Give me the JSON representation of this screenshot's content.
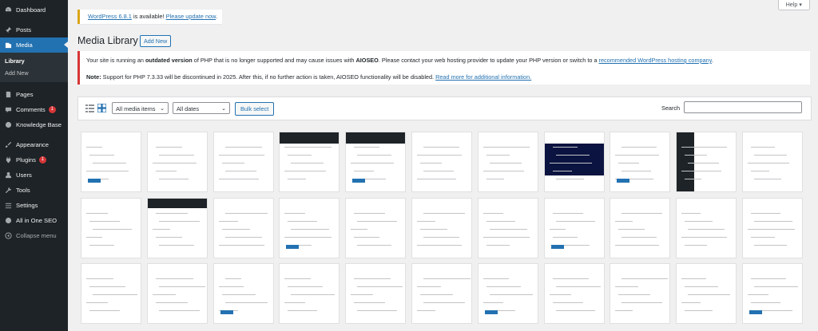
{
  "sidebar": {
    "items": [
      {
        "label": "Dashboard",
        "icon": "dashboard-icon"
      },
      {
        "label": "Posts",
        "icon": "pin-icon"
      },
      {
        "label": "Media",
        "icon": "media-icon",
        "active": true
      },
      {
        "label": "Pages",
        "icon": "pages-icon"
      },
      {
        "label": "Comments",
        "icon": "comment-icon",
        "badge": "1"
      },
      {
        "label": "Knowledge Base",
        "icon": "knowledge-base-icon"
      },
      {
        "label": "Appearance",
        "icon": "brush-icon"
      },
      {
        "label": "Plugins",
        "icon": "plugin-icon",
        "badge": "1"
      },
      {
        "label": "Users",
        "icon": "users-icon"
      },
      {
        "label": "Tools",
        "icon": "wrench-icon"
      },
      {
        "label": "Settings",
        "icon": "settings-icon"
      },
      {
        "label": "All in One SEO",
        "icon": "aioseo-icon"
      },
      {
        "label": "Collapse menu",
        "icon": "collapse-icon"
      }
    ],
    "media_submenu": [
      "Library",
      "Add New"
    ]
  },
  "help": {
    "label": "Help ▾"
  },
  "update_notice": {
    "link": "WordPress 6.8.1",
    "text": " is available! ",
    "action": "Please update now",
    "end": "."
  },
  "header": {
    "title": "Media Library",
    "add_new": "Add New"
  },
  "php_notice": {
    "line1_a": "Your site is running an ",
    "line1_b": "outdated version",
    "line1_c": " of PHP that is no longer supported and may cause issues with ",
    "line1_d": "AIOSEO",
    "line1_e": ". Please contact your web hosting provider to update your PHP version or switch to a ",
    "line1_link": "recommended WordPress hosting company",
    "line1_f": ".",
    "line2_a": "Note:",
    "line2_b": " Support for PHP 7.3.33 will be discontinued in 2025. After this, if no further action is taken, AIOSEO functionality will be disabled. ",
    "line2_link": "Read more for additional information."
  },
  "toolbar": {
    "filter_type": "All media items",
    "filter_date": "All dates",
    "bulk_select": "Bulk select",
    "search_label": "Search",
    "search_value": ""
  },
  "grid": {
    "rows": 3,
    "cols": 11
  }
}
